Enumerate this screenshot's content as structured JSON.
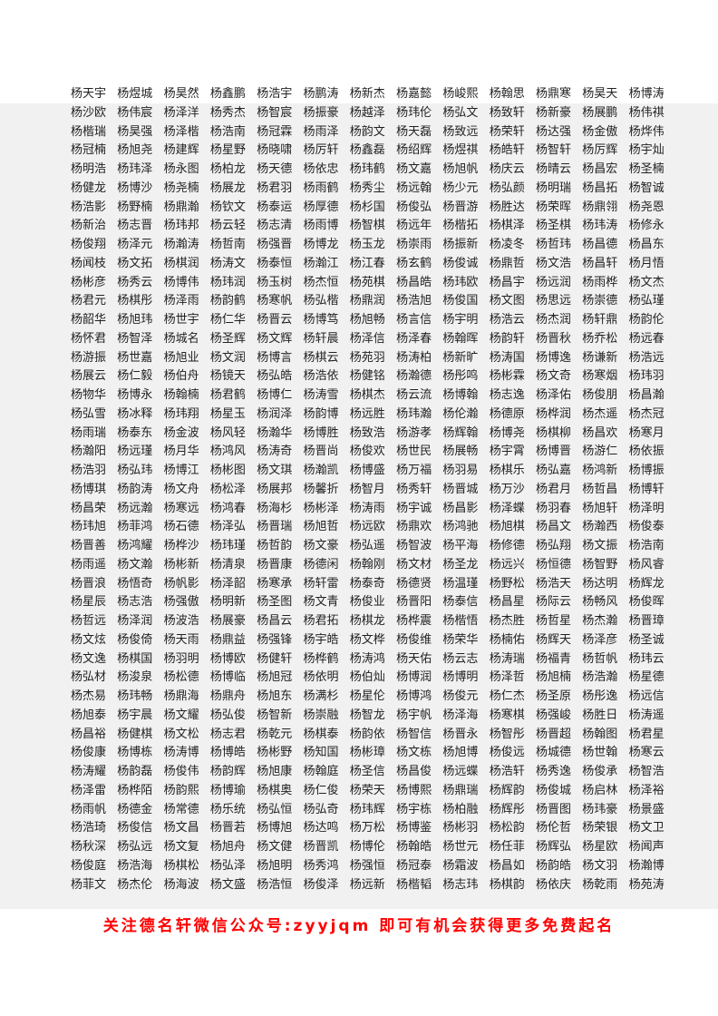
{
  "names": [
    [
      "杨天宇",
      "杨煜城",
      "杨昊然",
      "杨鑫鹏",
      "杨浩宇",
      "杨鹏涛",
      "杨新杰",
      "杨嘉懿",
      "杨峻熙",
      "杨翰思",
      "杨鼎寒",
      "杨昊天",
      "杨博涛"
    ],
    [
      "杨沙欧",
      "杨伟宸",
      "杨泽洋",
      "杨秀杰",
      "杨智宸",
      "杨振豪",
      "杨越泽",
      "杨玮伦",
      "杨弘文",
      "杨致轩",
      "杨新豪",
      "杨展鹏",
      "杨伟祺"
    ],
    [
      "杨楷瑞",
      "杨昊强",
      "杨泽楷",
      "杨浩南",
      "杨冠霖",
      "杨雨泽",
      "杨韵文",
      "杨天磊",
      "杨致远",
      "杨荣轩",
      "杨达强",
      "杨金傲",
      "杨烨伟"
    ],
    [
      "杨冠楠",
      "杨旭尧",
      "杨建辉",
      "杨星野",
      "杨晓啸",
      "杨厉轩",
      "杨鑫磊",
      "杨绍辉",
      "杨煜祺",
      "杨皓轩",
      "杨智轩",
      "杨厉辉",
      "杨宇灿"
    ],
    [
      "杨明浩",
      "杨玮泽",
      "杨永图",
      "杨柏龙",
      "杨天德",
      "杨依忠",
      "杨玮鹤",
      "杨文嘉",
      "杨旭帆",
      "杨庆云",
      "杨晴云",
      "杨昌宏",
      "杨圣楠"
    ],
    [
      "杨健龙",
      "杨博沙",
      "杨尧楠",
      "杨展龙",
      "杨君羽",
      "杨雨鹤",
      "杨秀尘",
      "杨远翰",
      "杨少元",
      "杨弘颜",
      "杨明瑞",
      "杨昌拓",
      "杨智诚"
    ],
    [
      "杨浩影",
      "杨野楠",
      "杨鼎瀚",
      "杨钦文",
      "杨泰运",
      "杨厚德",
      "杨杉国",
      "杨俊弘",
      "杨晋游",
      "杨胜达",
      "杨荣晖",
      "杨鼎翎",
      "杨尧恩"
    ],
    [
      "杨新治",
      "杨志晋",
      "杨玮邦",
      "杨云轻",
      "杨志清",
      "杨雨博",
      "杨智棋",
      "杨远年",
      "杨楷拓",
      "杨棋泽",
      "杨圣棋",
      "杨玮涛",
      "杨修永"
    ],
    [
      "杨俊翔",
      "杨泽元",
      "杨瀚涛",
      "杨哲南",
      "杨强晋",
      "杨博龙",
      "杨玉龙",
      "杨崇雨",
      "杨振新",
      "杨凌冬",
      "杨哲玮",
      "杨昌德",
      "杨昌东"
    ],
    [
      "杨闻枝",
      "杨文拓",
      "杨棋润",
      "杨涛文",
      "杨泰恒",
      "杨瀚江",
      "杨江春",
      "杨玄鹤",
      "杨俊诚",
      "杨鼎哲",
      "杨文浩",
      "杨昌轩",
      "杨月悟"
    ],
    [
      "杨彬彦",
      "杨秀云",
      "杨博伟",
      "杨玮润",
      "杨玉树",
      "杨杰恒",
      "杨苑棋",
      "杨昌皓",
      "杨玮欧",
      "杨昌宇",
      "杨远润",
      "杨雨桦",
      "杨文杰"
    ],
    [
      "杨君元",
      "杨棋彤",
      "杨泽雨",
      "杨韵鹤",
      "杨寒帆",
      "杨弘楷",
      "杨鼎润",
      "杨浩旭",
      "杨俊国",
      "杨文图",
      "杨思远",
      "杨崇德",
      "杨弘瑾"
    ],
    [
      "杨韶华",
      "杨旭玮",
      "杨世宇",
      "杨仁华",
      "杨晋云",
      "杨博笃",
      "杨旭畅",
      "杨言信",
      "杨宇明",
      "杨浩云",
      "杨杰润",
      "杨轩鼎",
      "杨韵伦"
    ],
    [
      "杨怀君",
      "杨智泽",
      "杨城名",
      "杨圣辉",
      "杨文辉",
      "杨轩晨",
      "杨泽信",
      "杨泽春",
      "杨翰晖",
      "杨韵轩",
      "杨晋秋",
      "杨乔松",
      "杨远春"
    ],
    [
      "杨游振",
      "杨世嘉",
      "杨旭业",
      "杨文润",
      "杨博言",
      "杨棋云",
      "杨苑羽",
      "杨涛柏",
      "杨新旷",
      "杨涛国",
      "杨博逸",
      "杨谦新",
      "杨浩远"
    ],
    [
      "杨展云",
      "杨仁毅",
      "杨伯舟",
      "杨镜天",
      "杨弘皓",
      "杨浩依",
      "杨健铭",
      "杨瀚德",
      "杨彤鸣",
      "杨彬霖",
      "杨文奇",
      "杨寒烟",
      "杨玮羽"
    ],
    [
      "杨物华",
      "杨博永",
      "杨翰楠",
      "杨君鹤",
      "杨博仁",
      "杨涛雪",
      "杨棋杰",
      "杨云流",
      "杨博翰",
      "杨志逸",
      "杨泽佑",
      "杨俊朋",
      "杨昌瀚"
    ],
    [
      "杨弘雪",
      "杨冰释",
      "杨玮翔",
      "杨星玉",
      "杨润泽",
      "杨韵博",
      "杨远胜",
      "杨玮瀚",
      "杨伦瀚",
      "杨德原",
      "杨桦润",
      "杨杰遥",
      "杨杰冠"
    ],
    [
      "杨雨瑞",
      "杨泰东",
      "杨金波",
      "杨风轻",
      "杨瀚华",
      "杨博胜",
      "杨致浩",
      "杨游孝",
      "杨辉翰",
      "杨博尧",
      "杨棋柳",
      "杨昌欢",
      "杨寒月"
    ],
    [
      "杨瀚阳",
      "杨远瑾",
      "杨月华",
      "杨鸿风",
      "杨涛奇",
      "杨晋尚",
      "杨俊欢",
      "杨世民",
      "杨展畅",
      "杨宇霄",
      "杨博晋",
      "杨游仁",
      "杨依振"
    ],
    [
      "杨浩羽",
      "杨弘玮",
      "杨博江",
      "杨彬图",
      "杨文琪",
      "杨瀚凯",
      "杨博盛",
      "杨万福",
      "杨羽易",
      "杨棋乐",
      "杨弘嘉",
      "杨鸿新",
      "杨博振"
    ],
    [
      "杨博琪",
      "杨韵涛",
      "杨文舟",
      "杨松泽",
      "杨展邦",
      "杨馨折",
      "杨智月",
      "杨秀轩",
      "杨晋城",
      "杨万沙",
      "杨君月",
      "杨哲昌",
      "杨博轩"
    ],
    [
      "杨昌荣",
      "杨远瀚",
      "杨寒远",
      "杨鸿春",
      "杨海杉",
      "杨彬泽",
      "杨涛雨",
      "杨宇诚",
      "杨昌影",
      "杨泽蝶",
      "杨羽春",
      "杨旭轩",
      "杨泽明"
    ],
    [
      "杨玮旭",
      "杨菲鸿",
      "杨石德",
      "杨泽弘",
      "杨晋瑞",
      "杨旭哲",
      "杨远欧",
      "杨鼎欢",
      "杨鸿驰",
      "杨旭棋",
      "杨昌文",
      "杨瀚西",
      "杨俊泰"
    ],
    [
      "杨晋善",
      "杨鸿耀",
      "杨桦沙",
      "杨玮瑾",
      "杨哲韵",
      "杨文豪",
      "杨弘遥",
      "杨智波",
      "杨平海",
      "杨修德",
      "杨弘翔",
      "杨文振",
      "杨浩南"
    ],
    [
      "杨雨遥",
      "杨文瀚",
      "杨彬新",
      "杨清泉",
      "杨晋康",
      "杨德闲",
      "杨翰刚",
      "杨文材",
      "杨圣龙",
      "杨远兴",
      "杨恒德",
      "杨智野",
      "杨风睿"
    ],
    [
      "杨晋浪",
      "杨悟奇",
      "杨帆影",
      "杨泽韶",
      "杨寒承",
      "杨轩雷",
      "杨泰奇",
      "杨德贤",
      "杨温瑾",
      "杨野松",
      "杨浩天",
      "杨达明",
      "杨辉龙"
    ],
    [
      "杨星辰",
      "杨志浩",
      "杨强傲",
      "杨明新",
      "杨圣图",
      "杨文青",
      "杨俊业",
      "杨晋阳",
      "杨泰信",
      "杨昌星",
      "杨际云",
      "杨畅风",
      "杨俊晖"
    ],
    [
      "杨哲远",
      "杨泽润",
      "杨波浩",
      "杨展豪",
      "杨昌云",
      "杨君拓",
      "杨棋龙",
      "杨桦震",
      "杨楷悟",
      "杨杰胜",
      "杨哲星",
      "杨杰瀚",
      "杨晋璋"
    ],
    [
      "杨文炫",
      "杨俊倚",
      "杨天雨",
      "杨鼎益",
      "杨强锋",
      "杨宇皓",
      "杨文桦",
      "杨俊维",
      "杨荣华",
      "杨楠佑",
      "杨辉天",
      "杨泽彦",
      "杨圣诚"
    ],
    [
      "杨文逸",
      "杨棋国",
      "杨羽明",
      "杨博欧",
      "杨健轩",
      "杨桦鹤",
      "杨涛鸿",
      "杨天佑",
      "杨云志",
      "杨涛瑞",
      "杨福青",
      "杨哲帆",
      "杨玮云"
    ],
    [
      "杨弘材",
      "杨浚泉",
      "杨松德",
      "杨博临",
      "杨旭冠",
      "杨依明",
      "杨伯灿",
      "杨博润",
      "杨博明",
      "杨泽哲",
      "杨旭楠",
      "杨浩瀚",
      "杨星德"
    ],
    [
      "杨杰易",
      "杨玮畅",
      "杨鼎海",
      "杨鼎舟",
      "杨旭东",
      "杨满杉",
      "杨星伦",
      "杨博鸿",
      "杨俊元",
      "杨仁杰",
      "杨圣原",
      "杨彤逸",
      "杨远信"
    ],
    [
      "杨旭泰",
      "杨宇晨",
      "杨文耀",
      "杨弘俊",
      "杨智新",
      "杨崇融",
      "杨智龙",
      "杨宇帆",
      "杨泽海",
      "杨寒棋",
      "杨强峻",
      "杨胜日",
      "杨涛遥"
    ],
    [
      "杨昌裕",
      "杨健棋",
      "杨文松",
      "杨志君",
      "杨乾元",
      "杨棋泰",
      "杨韵依",
      "杨智信",
      "杨晋永",
      "杨智彤",
      "杨晋超",
      "杨翰图",
      "杨君星"
    ],
    [
      "杨俊康",
      "杨博栋",
      "杨涛博",
      "杨博皓",
      "杨彬野",
      "杨知国",
      "杨彬璋",
      "杨文栋",
      "杨旭博",
      "杨俊远",
      "杨城德",
      "杨世翰",
      "杨寒云"
    ],
    [
      "杨涛耀",
      "杨韵磊",
      "杨俊伟",
      "杨韵辉",
      "杨旭康",
      "杨翰庭",
      "杨圣信",
      "杨昌俊",
      "杨远蝶",
      "杨浩轩",
      "杨秀逸",
      "杨俊承",
      "杨智浩"
    ],
    [
      "杨泽雷",
      "杨桦陌",
      "杨韵熙",
      "杨博瑜",
      "杨棋奥",
      "杨仁俊",
      "杨荣天",
      "杨博熙",
      "杨鼎瑞",
      "杨辉韵",
      "杨俊城",
      "杨启林",
      "杨泽裕"
    ],
    [
      "杨雨帆",
      "杨德金",
      "杨常德",
      "杨乐统",
      "杨弘恒",
      "杨弘奇",
      "杨玮辉",
      "杨宇栋",
      "杨柏融",
      "杨辉彤",
      "杨晋图",
      "杨玮豪",
      "杨景盛"
    ],
    [
      "杨浩琦",
      "杨俊信",
      "杨文昌",
      "杨晋若",
      "杨博旭",
      "杨达鸣",
      "杨万松",
      "杨博鉴",
      "杨彬羽",
      "杨松韵",
      "杨伦哲",
      "杨荣银",
      "杨文卫"
    ],
    [
      "杨秋深",
      "杨弘远",
      "杨文复",
      "杨旭舟",
      "杨文健",
      "杨晋凯",
      "杨博伦",
      "杨翰皓",
      "杨世元",
      "杨任菲",
      "杨辉弘",
      "杨星欧",
      "杨闻声"
    ],
    [
      "杨俊庭",
      "杨浩海",
      "杨棋松",
      "杨弘泽",
      "杨旭明",
      "杨秀鸿",
      "杨强恒",
      "杨冠泰",
      "杨霜波",
      "杨昌如",
      "杨韵皓",
      "杨文羽",
      "杨瀚博"
    ],
    [
      "杨菲文",
      "杨杰伦",
      "杨海波",
      "杨文盛",
      "杨浩恒",
      "杨俊泽",
      "杨远新",
      "杨楷韬",
      "杨志玮",
      "杨棋韵",
      "杨依庆",
      "杨乾雨",
      "杨苑涛"
    ]
  ],
  "footer": {
    "text": "关注德名轩微信公众号:zyyjqm 即可有机会获得更多免费起名",
    "color": "#ff0000"
  }
}
